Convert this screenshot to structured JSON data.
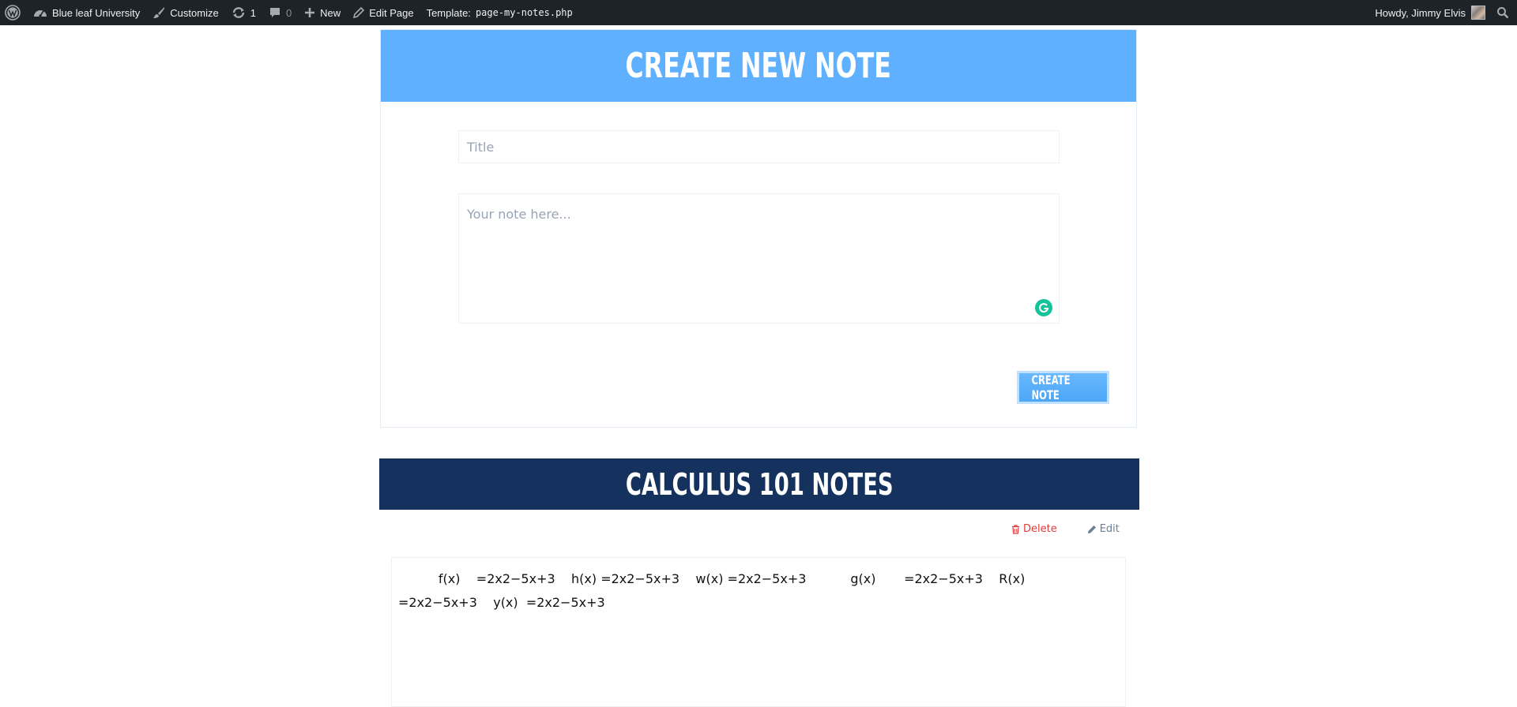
{
  "adminbar": {
    "site_name": "Blue leaf University",
    "customize": "Customize",
    "updates_count": "1",
    "comments_count": "0",
    "new_label": "New",
    "edit_page": "Edit Page",
    "template_label": "Template:",
    "template_file": "page-my-notes.php",
    "greeting": "Howdy, Jimmy Elvis"
  },
  "create_note": {
    "heading": "Create New Note",
    "title_placeholder": "Title",
    "body_placeholder": "Your note here...",
    "button_label": "Create Note"
  },
  "note": {
    "heading": "Calculus 101 Notes",
    "delete_label": "Delete",
    "edit_label": "Edit",
    "content": "          f(x)    =2x2−5x+3    h(x) =2x2−5x+3    w(x) =2x2−5x+3           g(x)       =2x2−5x+3    R(x)\n=2x2−5x+3    y(x)  =2x2−5x+3"
  },
  "colors": {
    "adminbar_bg": "#1d2327",
    "create_header": "#5fb0ff",
    "notes_header": "#15315e",
    "delete": "#dd3a3a",
    "grammarly": "#15c39a"
  }
}
